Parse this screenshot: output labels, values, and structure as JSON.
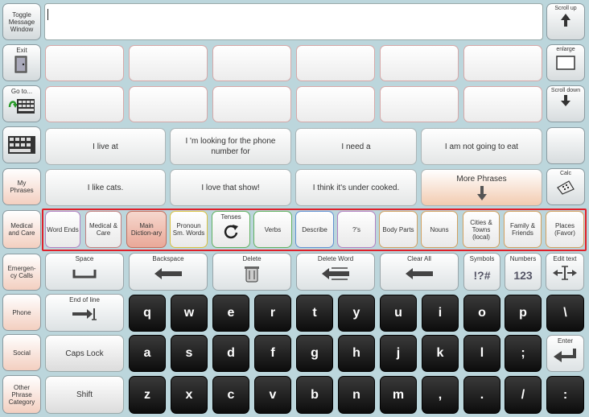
{
  "left_column": {
    "toggle": "Toggle Message Window",
    "exit": "Exit",
    "goto": "Go to...",
    "my_phrases": "My Phrases",
    "medical": "Medical and Care",
    "emergency": "Emergen-cy Calls",
    "phone": "Phone",
    "social": "Social",
    "other": "Other Phrase Category"
  },
  "right_column": {
    "scroll_up": "Scroll up",
    "enlarge": "enlarge",
    "scroll_down": "Scroll down",
    "calc": "Calc",
    "edit_text": "Edit text",
    "enter": "Enter"
  },
  "message": {
    "text": ""
  },
  "phrases": {
    "row1": [
      "I live at",
      "I 'm looking for the phone number for",
      "I need a",
      "I am not going to eat"
    ],
    "row2": [
      "I like cats.",
      "I love that show!",
      "I think it's under cooked.",
      "More Phrases"
    ]
  },
  "categories": [
    "Word Ends",
    "Medical & Care",
    "Main Diction-ary",
    "Pronoun Sm. Words",
    "Tenses",
    "Verbs",
    "Describe",
    "?'s",
    "Body Parts",
    "Nouns",
    "Cities & Towns (local)",
    "Family & Friends",
    "Places (Favor)"
  ],
  "functions": {
    "space": "Space",
    "backspace": "Backspace",
    "delete": "Delete",
    "delete_word": "Delete Word",
    "clear_all": "Clear All",
    "symbols": "Symbols",
    "symbols_icon": "!?#",
    "numbers": "Numbers",
    "numbers_icon": "123",
    "end_of_line": "End of line",
    "caps_lock": "Caps Lock",
    "shift": "Shift"
  },
  "keys": {
    "row1": [
      "q",
      "w",
      "e",
      "r",
      "t",
      "y",
      "u",
      "i",
      "o",
      "p",
      "\\"
    ],
    "row2": [
      "a",
      "s",
      "d",
      "f",
      "g",
      "h",
      "j",
      "k",
      "l",
      ";"
    ],
    "row3": [
      "z",
      "x",
      "c",
      "v",
      "b",
      "n",
      "m",
      ",",
      ".",
      "/",
      ":"
    ]
  },
  "colors": {
    "frame": "#bcd6dc",
    "highlight_box": "#e0202a",
    "key_dark": "#111111",
    "category_accent": "#e9a898"
  }
}
